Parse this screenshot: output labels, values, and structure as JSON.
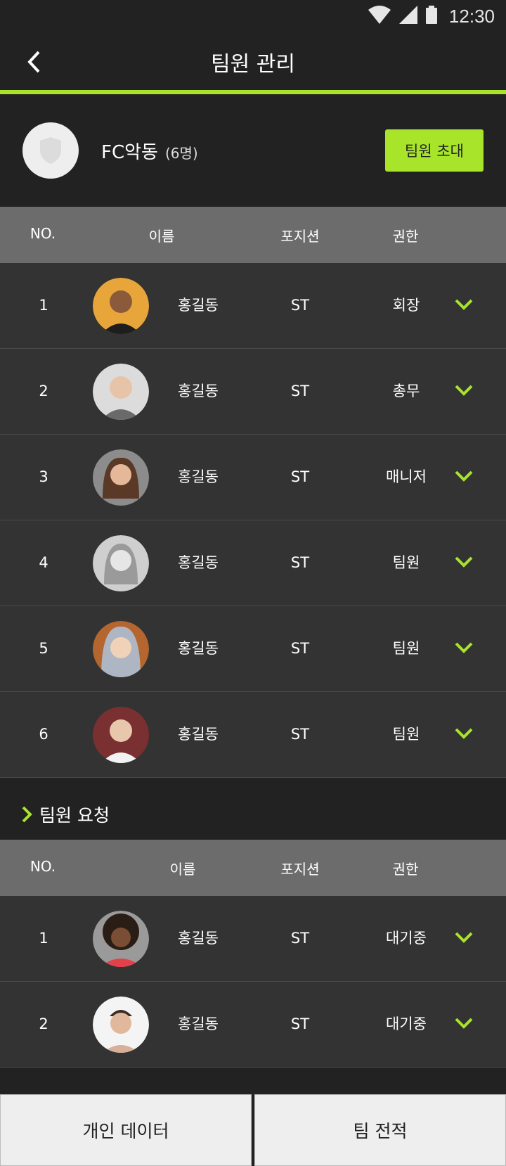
{
  "status": {
    "time": "12:30"
  },
  "appbar": {
    "title": "팀원 관리"
  },
  "team": {
    "name": "FC악동",
    "count": "(6명)",
    "invite_label": "팀원 초대"
  },
  "members_header": {
    "no": "NO.",
    "name": "이름",
    "position": "포지션",
    "role": "권한"
  },
  "members": [
    {
      "no": "1",
      "name": "홍길동",
      "position": "ST",
      "role": "회장"
    },
    {
      "no": "2",
      "name": "홍길동",
      "position": "ST",
      "role": "총무"
    },
    {
      "no": "3",
      "name": "홍길동",
      "position": "ST",
      "role": "매니저"
    },
    {
      "no": "4",
      "name": "홍길동",
      "position": "ST",
      "role": "팀원"
    },
    {
      "no": "5",
      "name": "홍길동",
      "position": "ST",
      "role": "팀원"
    },
    {
      "no": "6",
      "name": "홍길동",
      "position": "ST",
      "role": "팀원"
    }
  ],
  "requests": {
    "title": "팀원 요청",
    "header": {
      "no": "NO.",
      "name": "이름",
      "position": "포지션",
      "role": "권한"
    },
    "items": [
      {
        "no": "1",
        "name": "홍길동",
        "position": "ST",
        "role": "대기중"
      },
      {
        "no": "2",
        "name": "홍길동",
        "position": "ST",
        "role": "대기중"
      }
    ]
  },
  "bottom": {
    "personal_data": "개인 데이터",
    "team_record": "팀 전적"
  },
  "colors": {
    "accent": "#a8e52a",
    "background": "#222222",
    "row": "#333333",
    "header": "#6c6c6c"
  }
}
